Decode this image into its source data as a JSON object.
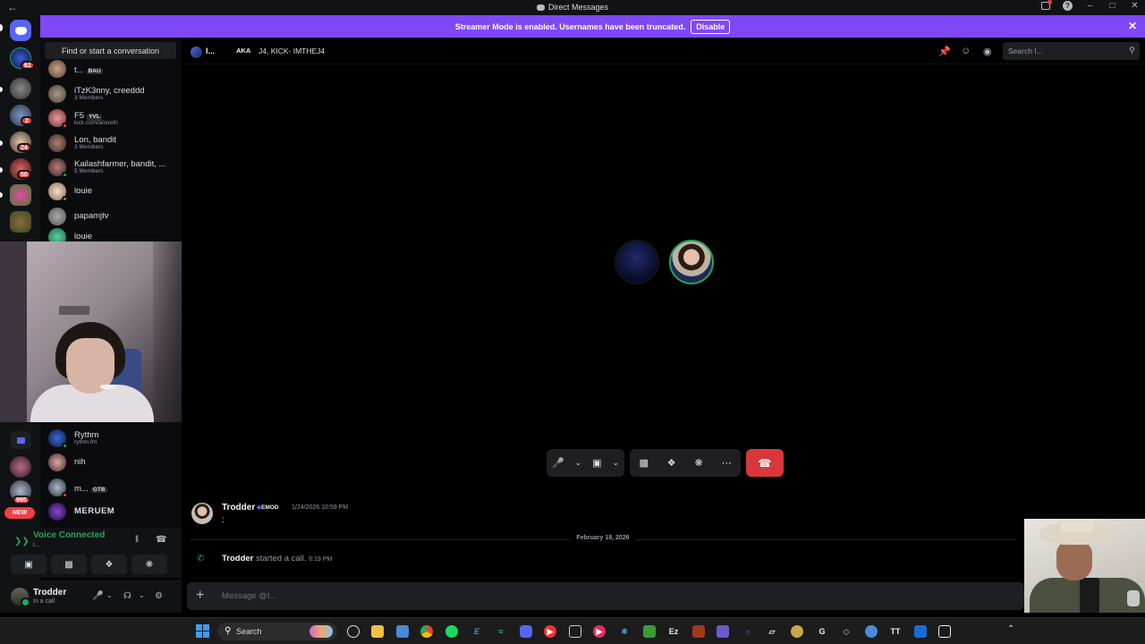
{
  "window": {
    "title": "Direct Messages"
  },
  "banner": {
    "text": "Streamer Mode is enabled. Usernames have been truncated.",
    "button": "Disable"
  },
  "rail": {
    "badges": [
      "61",
      "2",
      "24",
      "50",
      "995"
    ],
    "new_label": "NEW"
  },
  "dm_search": "Find or start a conversation",
  "dms": [
    {
      "name": "t...",
      "tag": "BAU",
      "sub": ""
    },
    {
      "name": "iTzK3nny, creeddd",
      "tag": "",
      "sub": "3 Members"
    },
    {
      "name": "F5",
      "tag": "YVL",
      "sub": "kick.com/amirefn"
    },
    {
      "name": "Lon, bandit",
      "tag": "",
      "sub": "3 Members"
    },
    {
      "name": "Kailashfarmer, bandit, ...",
      "tag": "",
      "sub": "5 Members"
    },
    {
      "name": "louie",
      "tag": "",
      "sub": ""
    },
    {
      "name": "papamjtv",
      "tag": "",
      "sub": ""
    },
    {
      "name": "louie",
      "tag": "",
      "sub": ""
    },
    {
      "name": "Rythm",
      "tag": "",
      "sub": "rythm.fm"
    },
    {
      "name": "nih",
      "tag": "",
      "sub": ""
    },
    {
      "name": "m...",
      "tag": "GTB",
      "sub": ""
    },
    {
      "name": "MERUEM",
      "tag": "",
      "sub": ""
    }
  ],
  "voice": {
    "title": "Voice Connected",
    "subtitle": "i..."
  },
  "user": {
    "name": "Trodder",
    "status": "In a call"
  },
  "header": {
    "name": "I...",
    "aka": "AKA",
    "aliases": "J4, KICK- IMTHEJ4",
    "search_placeholder": "Search I..."
  },
  "messages": {
    "first": {
      "author": "Trodder",
      "tag": "EMOD",
      "time": "1/24/2026 10:59 PM",
      "body": ":"
    },
    "date_divider": "February 18, 2026",
    "call": {
      "author": "Trodder",
      "text": "started a call.",
      "time": "6:19 PM"
    }
  },
  "composer": {
    "placeholder": "Message @I..."
  },
  "taskbar": {
    "search": "Search"
  },
  "colors": {
    "accent": "#5865f2",
    "banner": "#7e48f5",
    "online": "#23a55a",
    "danger": "#da373c"
  }
}
